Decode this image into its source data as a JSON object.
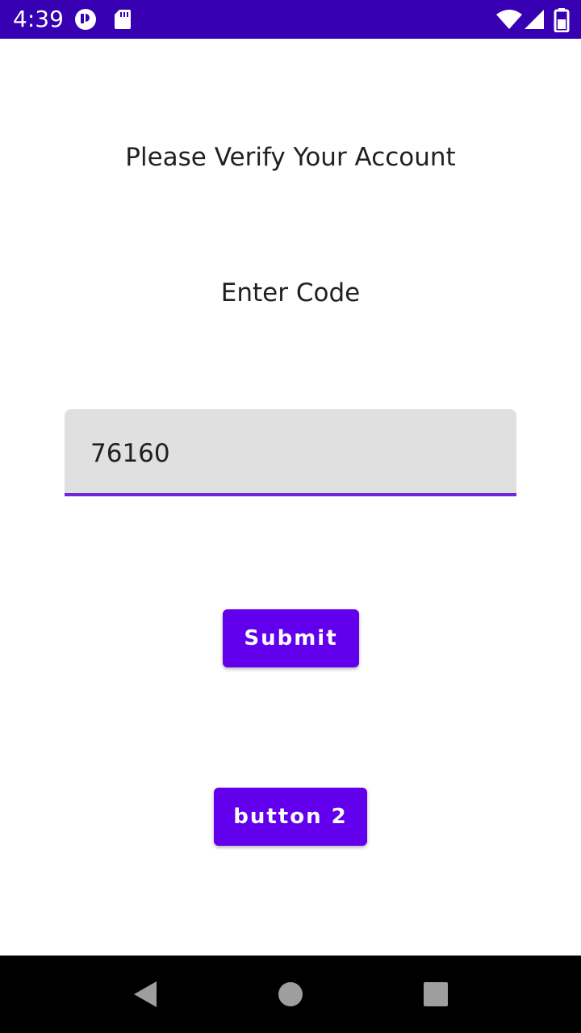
{
  "status_bar": {
    "time": "4:39",
    "background_color": "#3700b3",
    "icons": [
      "notification-app-icon",
      "sd-card-icon",
      "wifi-icon",
      "cell-signal-icon",
      "battery-icon"
    ]
  },
  "content": {
    "title": "Please Verify Your Account",
    "subtitle": "Enter Code",
    "code_input": {
      "value": "76160",
      "placeholder": ""
    },
    "submit_button": "Submit",
    "button2": "button 2"
  },
  "colors": {
    "accent": "#6200ee",
    "underline": "#6d28d9",
    "field_bg": "#e0e0e0"
  },
  "nav_bar": {
    "icons": [
      "back-icon",
      "home-icon",
      "recents-icon"
    ]
  }
}
